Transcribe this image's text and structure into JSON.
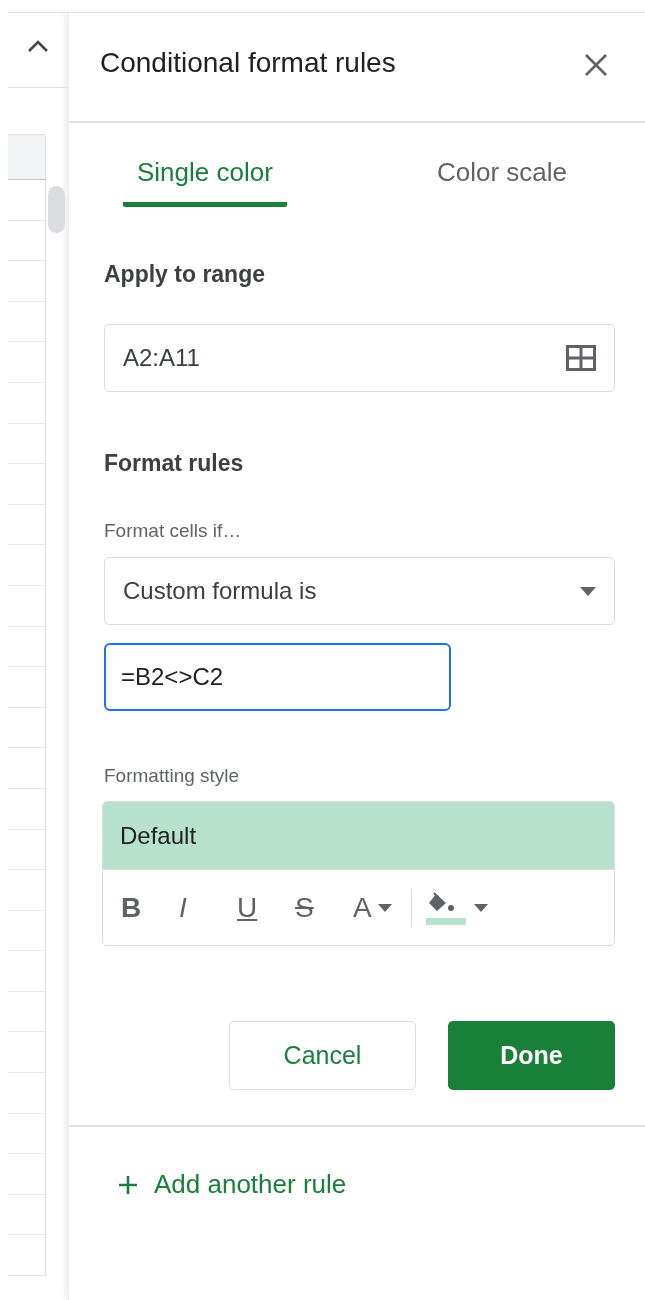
{
  "panel": {
    "title": "Conditional format rules"
  },
  "tabs": [
    {
      "label": "Single color",
      "selected": true
    },
    {
      "label": "Color scale",
      "selected": false
    }
  ],
  "range": {
    "label": "Apply to range",
    "value": "A2:A11"
  },
  "format_rules": {
    "heading": "Format rules",
    "condition_label": "Format cells if…",
    "condition": "Custom formula is",
    "formula": "=B2<>C2"
  },
  "formatting_style": {
    "label": "Formatting style",
    "preview": "Default",
    "tools": [
      {
        "kind": "bold",
        "label": "B"
      },
      {
        "kind": "italic",
        "label": "I"
      },
      {
        "kind": "underline",
        "label": "U"
      },
      {
        "kind": "strike",
        "label": "S"
      },
      {
        "kind": "text-color",
        "label": "A"
      },
      {
        "kind": "fill-color"
      }
    ]
  },
  "buttons": [
    {
      "kind": "secondary",
      "label": "Cancel"
    },
    {
      "kind": "primary",
      "label": "Done"
    }
  ],
  "add_rule": {
    "label": "Add another rule"
  }
}
